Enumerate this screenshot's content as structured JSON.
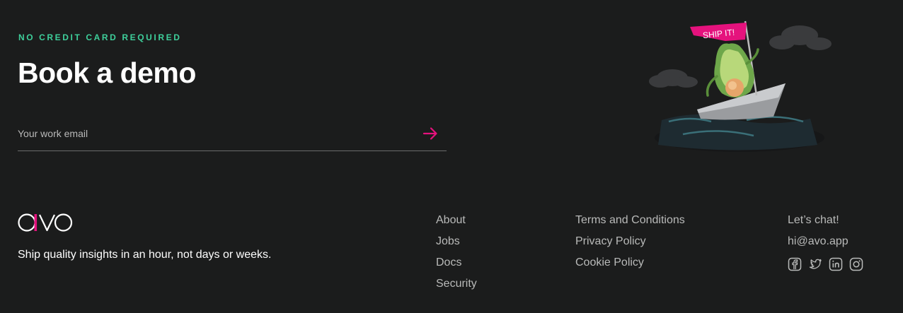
{
  "hero": {
    "eyebrow": "NO CREDIT CARD REQUIRED",
    "title": "Book a demo",
    "email_placeholder": "Your work email",
    "illustration_flag_text": "SHIP IT!"
  },
  "footer": {
    "logo_text": "avo",
    "tagline": "Ship quality insights in an hour, not days or weeks.",
    "links_col1": [
      "About",
      "Jobs",
      "Docs",
      "Security"
    ],
    "links_col2": [
      "Terms and Conditions",
      "Privacy Policy",
      "Cookie Policy"
    ],
    "contact_heading": "Let’s chat!",
    "contact_email": "hi@avo.app",
    "social_icons": [
      "facebook-icon",
      "twitter-icon",
      "linkedin-icon",
      "instagram-icon"
    ]
  },
  "colors": {
    "background": "#1b1c1c",
    "accent_pink": "#e5127d",
    "accent_green": "#3ecf9b",
    "muted_text": "#b9bab9"
  }
}
